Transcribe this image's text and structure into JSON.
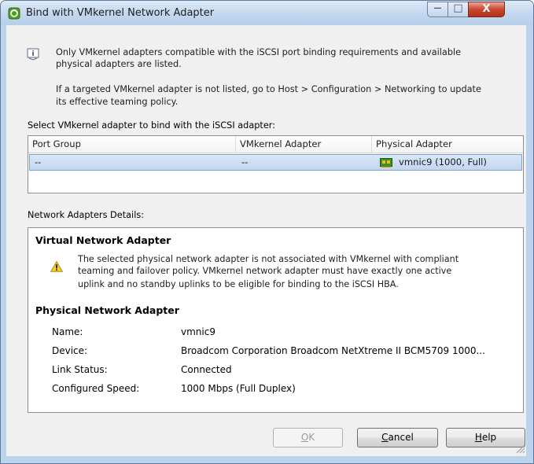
{
  "window": {
    "title": "Bind with VMkernel Network Adapter",
    "controls": {
      "minimize": "—",
      "maximize": "□",
      "close": "X"
    }
  },
  "info": {
    "icon": "info-icon",
    "line1": "Only VMkernel adapters compatible with the iSCSI port binding requirements and available",
    "line2": "physical adapters are listed.",
    "line3": "If a targeted VMkernel adapter is not listed, go to Host > Configuration > Networking to update",
    "line4": "its effective teaming policy."
  },
  "select_label": "Select VMkernel adapter to bind with the iSCSI adapter:",
  "table": {
    "columns": [
      "Port Group",
      "VMkernel Adapter",
      "Physical Adapter"
    ],
    "rows": [
      {
        "port_group": "--",
        "vmkernel_adapter": "--",
        "physical_adapter": "vmnic9 (1000, Full)",
        "icon": "network-card-icon",
        "selected": true
      }
    ]
  },
  "details_label": "Network Adapters Details:",
  "virtual_adapter": {
    "heading": "Virtual Network Adapter",
    "warning_icon": "warning-icon",
    "warning_line1": "The selected physical network adapter is not associated with VMkernel with compliant",
    "warning_line2": "teaming and failover policy. VMkernel network adapter must have exactly one active",
    "warning_line3": "uplink and no standby uplinks to be eligible for binding to the iSCSI HBA."
  },
  "physical_adapter": {
    "heading": "Physical Network Adapter",
    "props": [
      {
        "label": "Name:",
        "value": "vmnic9"
      },
      {
        "label": "Device:",
        "value": "Broadcom Corporation Broadcom NetXtreme II BCM5709 1000..."
      },
      {
        "label": "Link Status:",
        "value": "Connected"
      },
      {
        "label": "Configured Speed:",
        "value": "1000 Mbps (Full Duplex)"
      }
    ]
  },
  "buttons": {
    "ok_first": "O",
    "ok_rest": "K",
    "ok_enabled": false,
    "cancel_first": "C",
    "cancel_rest": "ancel",
    "help_first": "H",
    "help_rest": "elp"
  },
  "colors": {
    "selection": "#c3d6ef",
    "title_bar": "#c3d7ee",
    "close_button": "#c8462f"
  }
}
